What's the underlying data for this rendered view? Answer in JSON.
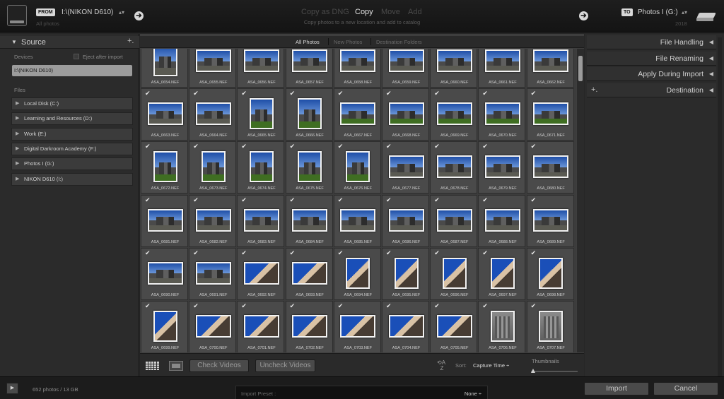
{
  "source": {
    "badge": "FROM",
    "title": "I:\\(NIKON D610)",
    "subtitle": "All photos",
    "panel_title": "Source",
    "devices_label": "Devices",
    "eject_label": "Eject after import",
    "selected_device": "I:\\(NIKON D610)",
    "files_label": "Files",
    "volumes": [
      "Local Disk (C:)",
      "Learning and Resources (D:)",
      "Work (E:)",
      "Digital Darkroom Academy (F:)",
      "Photos I (G:)",
      "NIKON D610 (I:)"
    ]
  },
  "modes": {
    "items": [
      "Copy as DNG",
      "Copy",
      "Move",
      "Add"
    ],
    "active": "Copy",
    "description": "Copy photos to a new location and add to catalog"
  },
  "destination": {
    "badge": "TO",
    "title": "Photos I (G:)",
    "subtitle": "2018"
  },
  "view_tabs": [
    "All Photos",
    "New Photos",
    "Destination Folders"
  ],
  "grid": {
    "columns": 9,
    "rows": [
      {
        "checked": false,
        "files": [
          "ASA_0654.NEF",
          "ASA_0655.NEF",
          "ASA_0656.NEF",
          "ASA_0657.NEF",
          "ASA_0658.NEF",
          "ASA_0659.NEF",
          "ASA_0660.NEF",
          "ASA_0661.NEF",
          "ASA_0662.NEF"
        ],
        "kinds": [
          "p",
          "l",
          "l",
          "l",
          "l",
          "l",
          "l",
          "l",
          "l"
        ]
      },
      {
        "checked": true,
        "files": [
          "ASA_0663.NEF",
          "ASA_0664.NEF",
          "ASA_0665.NEF",
          "ASA_0666.NEF",
          "ASA_0667.NEF",
          "ASA_0668.NEF",
          "ASA_0669.NEF",
          "ASA_0670.NEF",
          "ASA_0671.NEF"
        ],
        "kinds": [
          "l",
          "l",
          "pg",
          "pg",
          "lg",
          "lg",
          "lg",
          "lg",
          "lg"
        ]
      },
      {
        "checked": true,
        "files": [
          "ASA_0672.NEF",
          "ASA_0673.NEF",
          "ASA_0674.NEF",
          "ASA_0675.NEF",
          "ASA_0676.NEF",
          "ASA_0677.NEF",
          "ASA_0678.NEF",
          "ASA_0679.NEF",
          "ASA_0680.NEF"
        ],
        "kinds": [
          "pg",
          "pg",
          "pg",
          "pg",
          "pg",
          "l",
          "l",
          "l",
          "l"
        ]
      },
      {
        "checked": true,
        "files": [
          "ASA_0681.NEF",
          "ASA_0682.NEF",
          "ASA_0683.NEF",
          "ASA_0684.NEF",
          "ASA_0685.NEF",
          "ASA_0686.NEF",
          "ASA_0687.NEF",
          "ASA_0688.NEF",
          "ASA_0689.NEF"
        ],
        "kinds": [
          "l",
          "l",
          "l",
          "l",
          "l",
          "l",
          "l",
          "l",
          "l"
        ]
      },
      {
        "checked": true,
        "files": [
          "ASA_0690.NEF",
          "ASA_0691.NEF",
          "ASA_0692.NEF",
          "ASA_0693.NEF",
          "ASA_0694.NEF",
          "ASA_0695.NEF",
          "ASA_0696.NEF",
          "ASA_0697.NEF",
          "ASA_0698.NEF"
        ],
        "kinds": [
          "l",
          "l",
          "lw",
          "lw",
          "pw",
          "pw",
          "pw",
          "pw",
          "pw"
        ]
      },
      {
        "checked": true,
        "files": [
          "ASA_0699.NEF",
          "ASA_0700.NEF",
          "ASA_0701.NEF",
          "ASA_0702.NEF",
          "ASA_0703.NEF",
          "ASA_0704.NEF",
          "ASA_0705.NEF",
          "ASA_0706.NEF",
          "ASA_0707.NEF"
        ],
        "kinds": [
          "pw",
          "lw",
          "lw",
          "lw",
          "lw",
          "lw",
          "lw",
          "pd",
          "pd"
        ]
      }
    ]
  },
  "toolbar": {
    "check_videos": "Check Videos",
    "uncheck_videos": "Uncheck Videos",
    "sort_label": "Sort:",
    "sort_value": "Capture Time ÷",
    "thumbnails_label": "Thumbnails",
    "thumbnail_size": 0
  },
  "right_panel": [
    "File Handling",
    "File Renaming",
    "Apply During Import",
    "Destination"
  ],
  "footer": {
    "count": "652 photos / 13 GB",
    "preset_label": "Import Preset :",
    "preset_value": "None ÷",
    "import": "Import",
    "cancel": "Cancel"
  },
  "colors": {
    "accent": "#e0e0e0",
    "panel": "#2b2b2b",
    "grid_cell": "#4a4a4a"
  }
}
